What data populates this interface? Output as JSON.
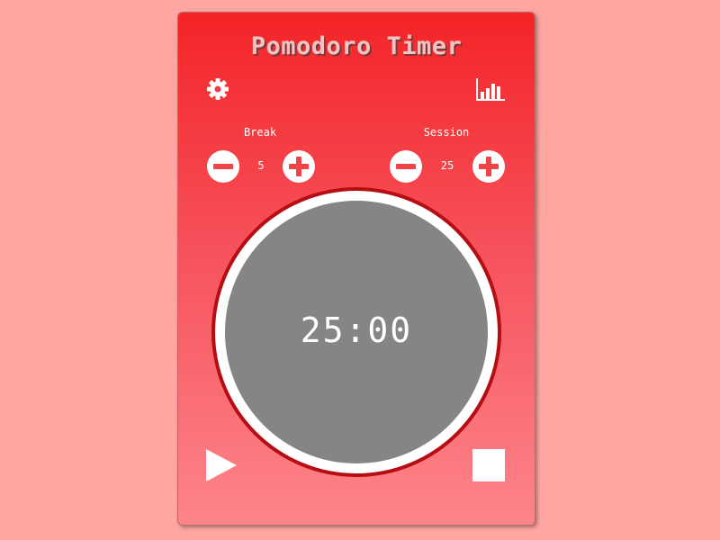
{
  "app": {
    "title": "Pomodoro Timer"
  },
  "toolbar": {
    "settings_icon": "gear-icon",
    "stats_icon": "bar-chart-icon"
  },
  "break": {
    "label": "Break",
    "value": "5",
    "minus_icon": "minus-circle-icon",
    "plus_icon": "plus-circle-icon"
  },
  "session": {
    "label": "Session",
    "value": "25",
    "minus_icon": "minus-circle-icon",
    "plus_icon": "plus-circle-icon"
  },
  "timer": {
    "display": "25:00"
  },
  "controls": {
    "play_icon": "play-icon",
    "stop_icon": "stop-icon"
  },
  "colors": {
    "page_background": "#ffa6a2",
    "card_gradient_top": "#f42427",
    "card_gradient_bottom": "#fd858a",
    "dial_border": "#b50d12",
    "dial_face": "#858585",
    "accent": "#f04348"
  }
}
